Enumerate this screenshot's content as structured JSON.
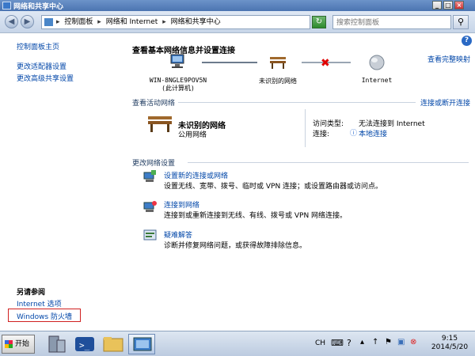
{
  "window": {
    "title": "网络和共享中心"
  },
  "addressbar": {
    "crumbs": [
      "控制面板",
      "网络和 Internet",
      "网络和共享中心"
    ],
    "search_placeholder": "搜索控制面板"
  },
  "sidebar": {
    "items": [
      {
        "label": "控制面板主页"
      },
      {
        "label": "更改适配器设置"
      },
      {
        "label": "更改高级共享设置"
      }
    ],
    "see_also": {
      "heading": "另请参阅",
      "items": [
        {
          "label": "Internet 选项"
        },
        {
          "label": "Windows 防火墙"
        }
      ]
    }
  },
  "main": {
    "heading": "查看基本网络信息并设置连接",
    "full_map_link": "查看完整映射",
    "map": {
      "computer_line1": "WIN-8NGLE9POV5N",
      "computer_line2": "(此计算机)",
      "network_label": "未识别的网络",
      "internet_label": "Internet"
    },
    "active": {
      "section_title": "查看活动网络",
      "connect_link": "连接或断开连接",
      "network_name": "未识别的网络",
      "network_type": "公用网络",
      "access_label": "访问类型:",
      "access_value": "无法连接到 Internet",
      "connection_label": "连接:",
      "connection_value": "本地连接"
    },
    "change": {
      "section_title": "更改网络设置",
      "tasks": [
        {
          "title": "设置新的连接或网络",
          "desc": "设置无线、宽带、拨号、临时或 VPN 连接；或设置路由器或访问点。"
        },
        {
          "title": "连接到网络",
          "desc": "连接到或重新连接到无线、有线、拨号或 VPN 网络连接。"
        },
        {
          "title": "疑难解答",
          "desc": "诊断并修复网络问题，或获得故障排除信息。"
        }
      ]
    }
  },
  "taskbar": {
    "start_label": "开始",
    "lang": "CH",
    "time": "9:15",
    "date": "2014/5/20"
  },
  "colors": {
    "link": "#0046a8",
    "titlebar": "#4b74b1",
    "error": "#e00000"
  }
}
